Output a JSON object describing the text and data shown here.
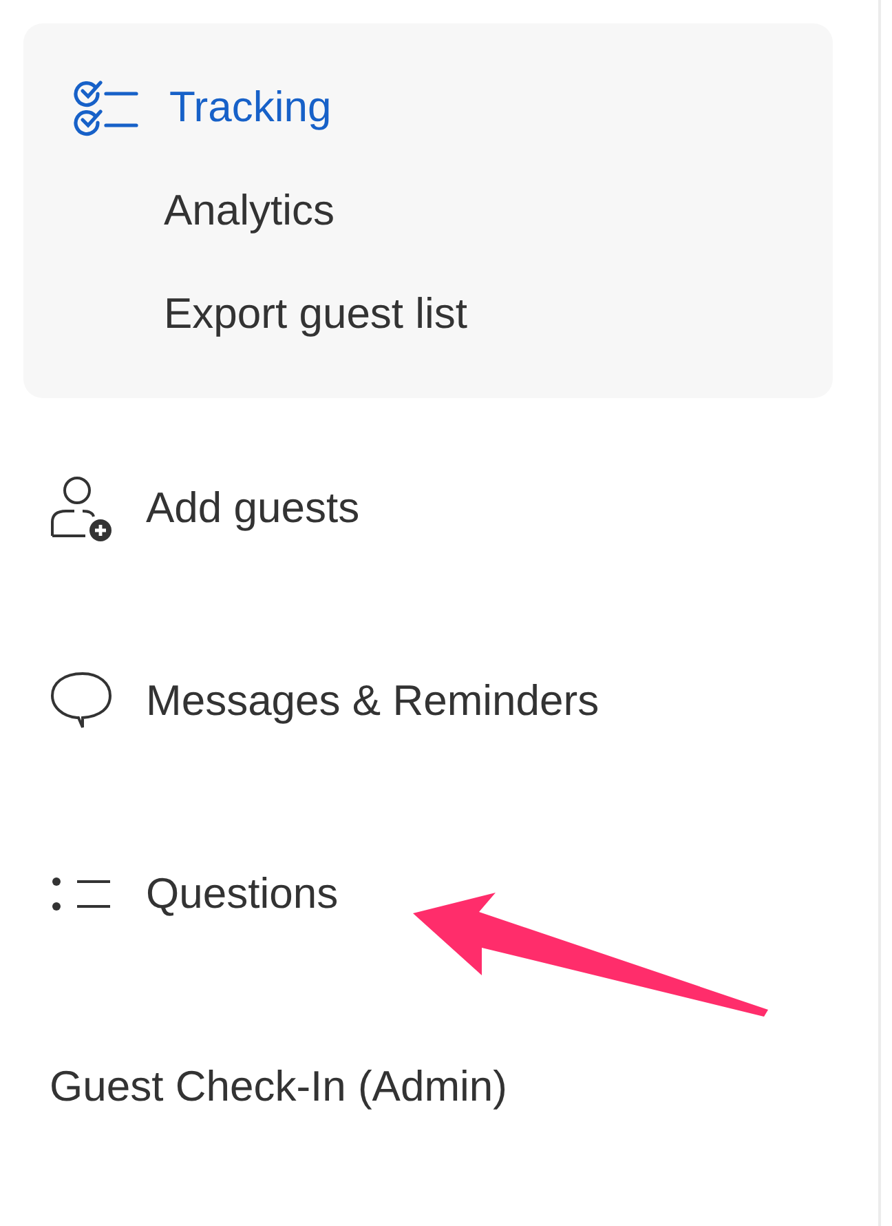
{
  "sidebar": {
    "items": [
      {
        "kind": "tracking",
        "label": "Tracking",
        "selected": true,
        "expanded": true,
        "children": [
          {
            "label": "Analytics",
            "selected": false
          },
          {
            "label": "Export guest list",
            "selected": false
          }
        ]
      },
      {
        "kind": "add-guests",
        "label": "Add guests",
        "selected": false
      },
      {
        "kind": "messages",
        "label": "Messages & Reminders",
        "selected": false
      },
      {
        "kind": "questions",
        "label": "Questions",
        "selected": false
      },
      {
        "kind": "plain",
        "label": "Guest Check-In (Admin)",
        "selected": false
      }
    ]
  },
  "annotation": {
    "kind": "arrow"
  }
}
